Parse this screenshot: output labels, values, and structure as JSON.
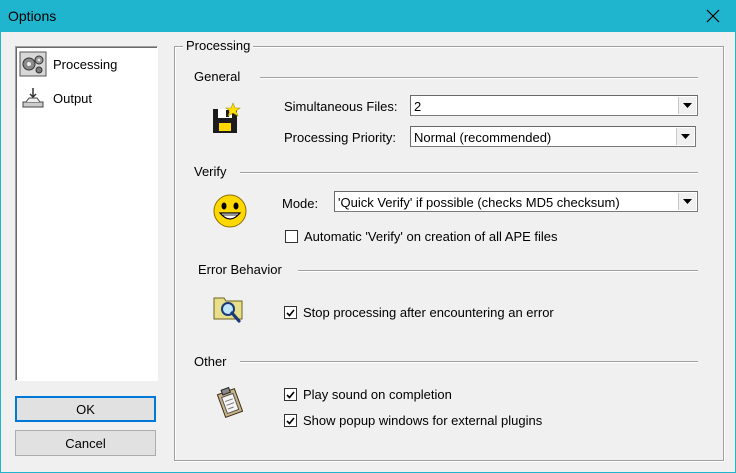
{
  "window": {
    "title": "Options"
  },
  "nav": {
    "items": [
      {
        "label": "Processing",
        "icon": "processing-gears-icon"
      },
      {
        "label": "Output",
        "icon": "output-tray-icon"
      }
    ]
  },
  "buttons": {
    "ok": "OK",
    "cancel": "Cancel"
  },
  "group": {
    "title": "Processing"
  },
  "general": {
    "heading": "General",
    "simultaneous_label": "Simultaneous Files:",
    "simultaneous_value": "2",
    "priority_label": "Processing Priority:",
    "priority_value": "Normal (recommended)"
  },
  "verify": {
    "heading": "Verify",
    "mode_label": "Mode:",
    "mode_value": "'Quick Verify' if possible (checks MD5 checksum)",
    "auto_label": "Automatic 'Verify' on creation of all APE files",
    "auto_checked": false
  },
  "error": {
    "heading": "Error Behavior",
    "stop_label": "Stop processing after encountering an error",
    "stop_checked": true
  },
  "other": {
    "heading": "Other",
    "sound_label": "Play sound on completion",
    "sound_checked": true,
    "popup_label": "Show popup windows for external plugins",
    "popup_checked": true
  },
  "colors": {
    "titlebar": "#1fb5cf",
    "accent": "#0078d7"
  }
}
